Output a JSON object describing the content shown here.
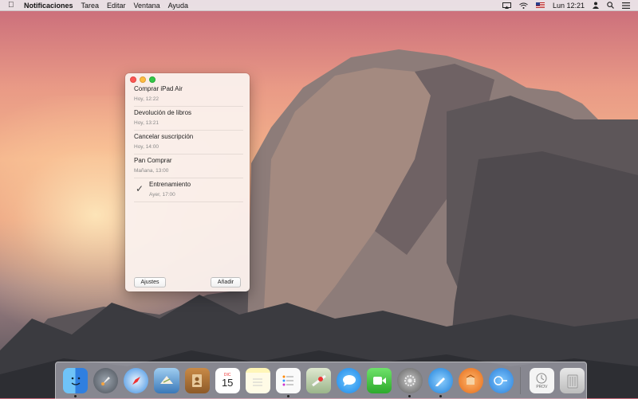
{
  "menubar": {
    "app_name": "Notificaciones",
    "menus": [
      "Tarea",
      "Editar",
      "Ventana",
      "Ayuda"
    ],
    "clock": "Lun 12:21"
  },
  "reminders": [
    {
      "title": "Comprar iPad Air",
      "date": "Hoy, 12:22",
      "completed": false
    },
    {
      "title": "Devolución de libros",
      "date": "Hoy, 13:21",
      "completed": false
    },
    {
      "title": "Cancelar suscripción",
      "date": "Hoy, 14:00",
      "completed": false
    },
    {
      "title": "Pan Comprar",
      "date": "Mañana, 13:00",
      "completed": false
    },
    {
      "title": "Entrenamiento",
      "date": "Ayer, 17:00",
      "completed": true
    }
  ],
  "buttons": {
    "settings": "Ajustes",
    "add": "Añadir"
  },
  "dock": {
    "calendar_month": "DIC",
    "calendar_day": "15",
    "preview_label": "PROV"
  },
  "colors": {
    "close": "#fc5753",
    "minimize": "#fdbc40",
    "maximize": "#33c748"
  }
}
